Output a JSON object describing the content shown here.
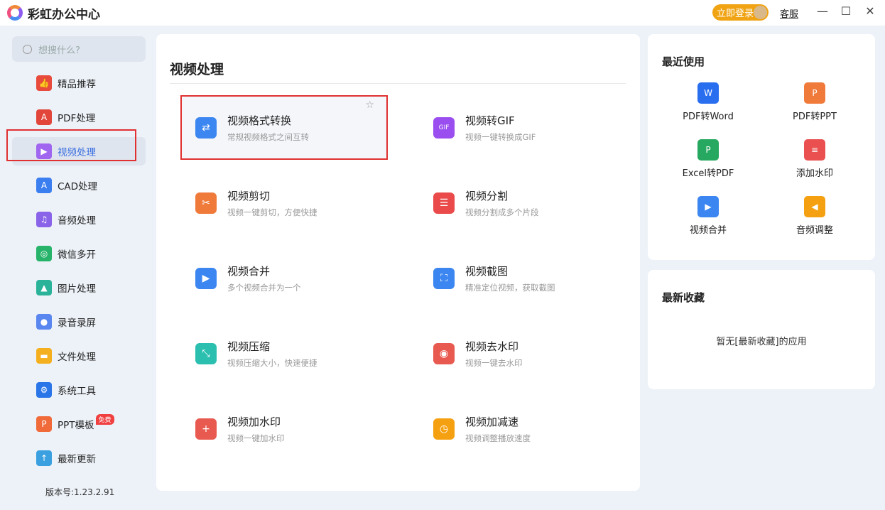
{
  "app": {
    "title": "彩虹办公中心",
    "login": "立即登录",
    "service": "客服"
  },
  "sidebar": {
    "search_placeholder": "想搜什么?",
    "items": [
      {
        "label": "精品推荐",
        "color": "#e84a3c",
        "icon": "👍"
      },
      {
        "label": "PDF处理",
        "color": "#e2463a",
        "icon": "A"
      },
      {
        "label": "视频处理",
        "color": "#a066f0",
        "icon": "▶"
      },
      {
        "label": "CAD处理",
        "color": "#3b7ef0",
        "icon": "A"
      },
      {
        "label": "音频处理",
        "color": "#8a64e8",
        "icon": "♫"
      },
      {
        "label": "微信多开",
        "color": "#27b36a",
        "icon": "◎"
      },
      {
        "label": "图片处理",
        "color": "#2bb39a",
        "icon": "▲"
      },
      {
        "label": "录音录屏",
        "color": "#5a86f0",
        "icon": "●"
      },
      {
        "label": "文件处理",
        "color": "#f5b020",
        "icon": "▬"
      },
      {
        "label": "系统工具",
        "color": "#2a75e8",
        "icon": "⚙"
      },
      {
        "label": "PPT模板",
        "color": "#f06a3a",
        "icon": "P",
        "badge": "免费"
      },
      {
        "label": "最新更新",
        "color": "#3aa0e0",
        "icon": "↑"
      }
    ],
    "version": "版本号:1.23.2.91"
  },
  "main": {
    "title": "视频处理",
    "tools": [
      {
        "title": "视频格式转换",
        "desc": "常规视频格式之间互转",
        "color": "#3b86f0",
        "icon": "⇄"
      },
      {
        "title": "视频转GIF",
        "desc": "视频一键转换成GIF",
        "color": "#9a4ef0",
        "icon": "GIF"
      },
      {
        "title": "视频剪切",
        "desc": "视频一键剪切，方便快捷",
        "color": "#f07a3a",
        "icon": "✂"
      },
      {
        "title": "视频分割",
        "desc": "视频分割成多个片段",
        "color": "#ea4a4a",
        "icon": "☰"
      },
      {
        "title": "视频合并",
        "desc": "多个视频合并为一个",
        "color": "#3b86f0",
        "icon": "▶"
      },
      {
        "title": "视频截图",
        "desc": "精准定位视频，获取截图",
        "color": "#3b86f0",
        "icon": "⛶"
      },
      {
        "title": "视频压缩",
        "desc": "视频压缩大小，快速便捷",
        "color": "#2bbfb0",
        "icon": "⤡"
      },
      {
        "title": "视频去水印",
        "desc": "视频一键去水印",
        "color": "#e85a50",
        "icon": "◉"
      },
      {
        "title": "视频加水印",
        "desc": "视频一键加水印",
        "color": "#e85a50",
        "icon": "+"
      },
      {
        "title": "视频加减速",
        "desc": "视频调整播放速度",
        "color": "#f5a010",
        "icon": "◷"
      }
    ]
  },
  "recent": {
    "title": "最近使用",
    "items": [
      {
        "label": "PDF转Word",
        "color": "#2a6ef0",
        "icon": "W"
      },
      {
        "label": "PDF转PPT",
        "color": "#f07a3a",
        "icon": "P"
      },
      {
        "label": "Excel转PDF",
        "color": "#27a860",
        "icon": "P"
      },
      {
        "label": "添加水印",
        "color": "#ea5050",
        "icon": "≡"
      },
      {
        "label": "视频合并",
        "color": "#3b86f0",
        "icon": "▶"
      },
      {
        "label": "音频调整",
        "color": "#f5a010",
        "icon": "◀"
      }
    ]
  },
  "favorites": {
    "title": "最新收藏",
    "empty": "暂无[最新收藏]的应用"
  }
}
